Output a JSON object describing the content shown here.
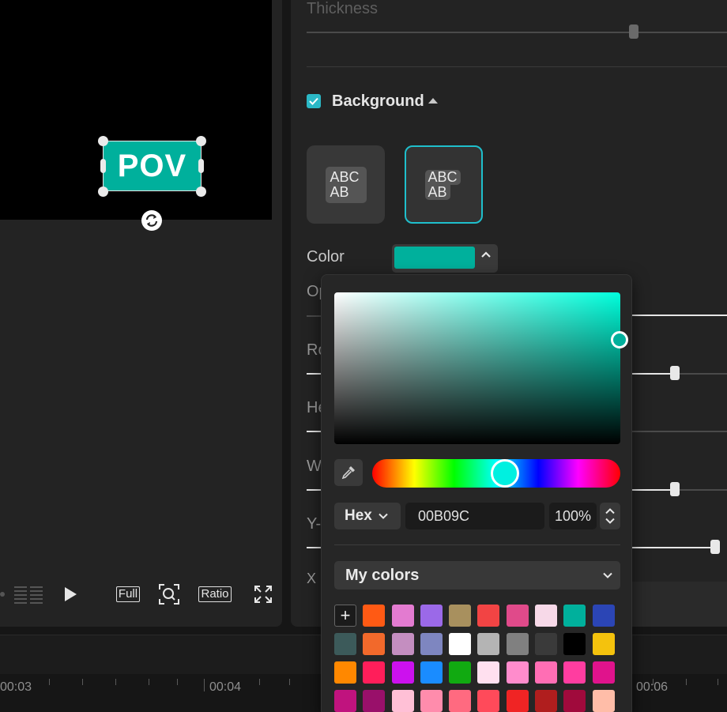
{
  "preview": {
    "text_clip": "POV",
    "controls": {
      "full_label": "Full",
      "ratio_label": "Ratio"
    }
  },
  "properties": {
    "thickness_label": "Thickness",
    "background": {
      "checked": true,
      "title": "Background"
    },
    "style_cards": [
      {
        "line1": "ABC",
        "line2": "AB"
      },
      {
        "line1": "ABC",
        "line2": "AB"
      }
    ],
    "color_label": "Color",
    "partial_labels": [
      "Op",
      "Ro",
      "He",
      "W",
      "Y-",
      "X"
    ]
  },
  "color_picker": {
    "mode": "Hex",
    "hex_value": "00B09C",
    "opacity": "100%",
    "my_colors_label": "My colors",
    "add_label": "+",
    "swatches": [
      "#ff5a14",
      "#e37bd0",
      "#9b69e8",
      "#a8905e",
      "#f24444",
      "#e04a8a",
      "#f7d9e8",
      "#00b09c",
      "#2b45b5",
      "#3c5a5a",
      "#f2692b",
      "#c48ec0",
      "#7e86c0",
      "#ffffff",
      "#b4b4b4",
      "#808080",
      "#3a3a3a",
      "#000000",
      "#f4c20d",
      "#ff8800",
      "#ff1e5a",
      "#cc11ee",
      "#1a8cff",
      "#11aa11",
      "#ffe0ef",
      "#ff8ccc",
      "#ff6eb4",
      "#ff3da0",
      "#e0138c",
      "#c0137e",
      "#99106a",
      "#ffc0d6",
      "#ff8cac",
      "#ff6a80",
      "#ff4a5a",
      "#f02424",
      "#b01e1e",
      "#a00a3c",
      "#ffbda8",
      "#ffffff"
    ]
  },
  "timeline": {
    "times": [
      "00:03",
      "00:04",
      "00:06"
    ]
  }
}
